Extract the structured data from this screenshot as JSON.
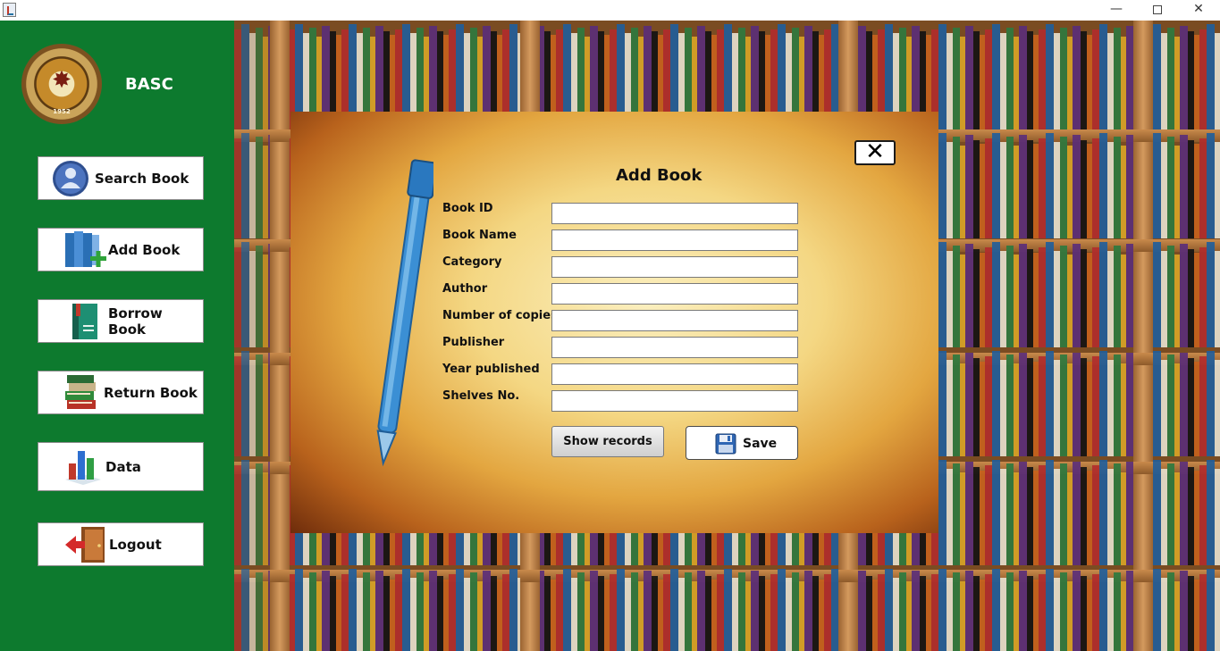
{
  "window": {
    "minimize": "—",
    "close": "✕"
  },
  "sidebar": {
    "brand": "BASC",
    "logo_year": "1952",
    "items": [
      {
        "label": "Search Book",
        "icon": "user-search-icon"
      },
      {
        "label": "Add Book",
        "icon": "add-book-icon"
      },
      {
        "label": "Borrow Book",
        "icon": "borrow-book-icon"
      },
      {
        "label": "Return Book",
        "icon": "return-book-icon"
      },
      {
        "label": "Data",
        "icon": "bar-chart-icon"
      },
      {
        "label": "Logout",
        "icon": "logout-door-icon"
      }
    ]
  },
  "dialog": {
    "title": "Add Book",
    "close_label": "✕",
    "fields": [
      {
        "label": "Book ID",
        "value": ""
      },
      {
        "label": "Book Name",
        "value": ""
      },
      {
        "label": "Category",
        "value": ""
      },
      {
        "label": "Author",
        "value": ""
      },
      {
        "label": "Number of copies",
        "value": ""
      },
      {
        "label": "Publisher",
        "value": ""
      },
      {
        "label": "Year published",
        "value": ""
      },
      {
        "label": "Shelves No.",
        "value": ""
      }
    ],
    "show_records_label": "Show records",
    "save_label": "Save"
  },
  "colors": {
    "sidebar": "#0d7a2e",
    "panel_light": "#fbefbf",
    "panel_dark": "#6e2c0b"
  }
}
